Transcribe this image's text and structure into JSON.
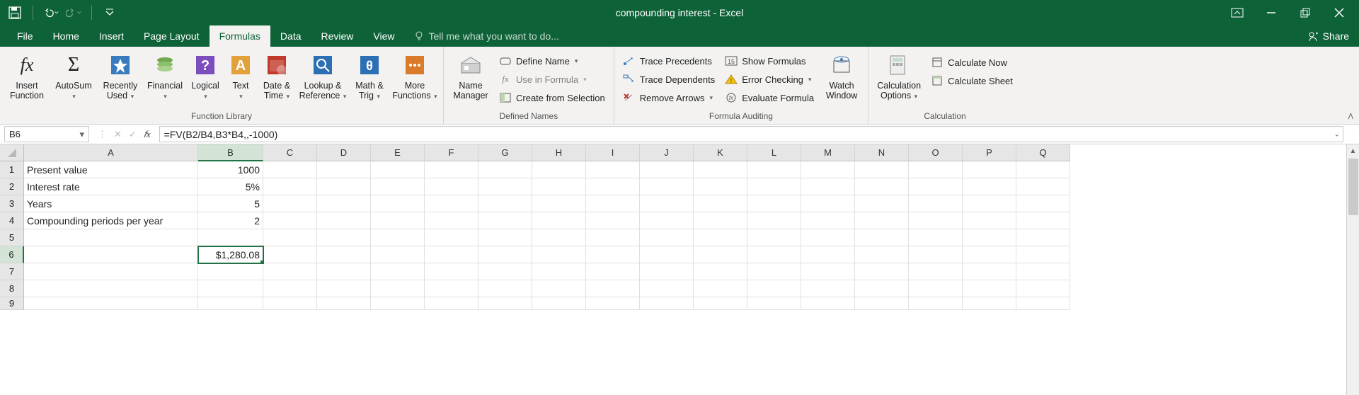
{
  "title": "compounding interest - Excel",
  "tabs": [
    "File",
    "Home",
    "Insert",
    "Page Layout",
    "Formulas",
    "Data",
    "Review",
    "View"
  ],
  "active_tab": "Formulas",
  "tell_me": "Tell me what you want to do...",
  "share": "Share",
  "ribbon": {
    "function_library": {
      "label": "Function Library",
      "insert_function": "Insert\nFunction",
      "autosum": "AutoSum",
      "recently_used": "Recently\nUsed",
      "financial": "Financial",
      "logical": "Logical",
      "text": "Text",
      "date_time": "Date &\nTime",
      "lookup_ref": "Lookup &\nReference",
      "math_trig": "Math &\nTrig",
      "more_functions": "More\nFunctions"
    },
    "defined_names": {
      "label": "Defined Names",
      "name_manager": "Name\nManager",
      "define_name": "Define Name",
      "use_in_formula": "Use in Formula",
      "create_from_selection": "Create from Selection"
    },
    "formula_auditing": {
      "label": "Formula Auditing",
      "trace_precedents": "Trace Precedents",
      "trace_dependents": "Trace Dependents",
      "remove_arrows": "Remove Arrows",
      "show_formulas": "Show Formulas",
      "error_checking": "Error Checking",
      "evaluate_formula": "Evaluate Formula",
      "watch_window": "Watch\nWindow"
    },
    "calculation": {
      "label": "Calculation",
      "calculation_options": "Calculation\nOptions",
      "calculate_now": "Calculate Now",
      "calculate_sheet": "Calculate Sheet"
    }
  },
  "name_box": "B6",
  "formula": "=FV(B2/B4,B3*B4,,-1000)",
  "columns": [
    "A",
    "B",
    "C",
    "D",
    "E",
    "F",
    "G",
    "H",
    "I",
    "J",
    "K",
    "L",
    "M",
    "N",
    "O",
    "P",
    "Q"
  ],
  "rows": [
    "1",
    "2",
    "3",
    "4",
    "5",
    "6",
    "7",
    "8",
    "9"
  ],
  "selected_col": "B",
  "selected_row": "6",
  "data": {
    "A1": "Present value",
    "B1": "1000",
    "A2": "Interest rate",
    "B2": "5%",
    "A3": "Years",
    "B3": "5",
    "A4": "Compounding periods per year",
    "B4": "2",
    "B6": "$1,280.08"
  }
}
